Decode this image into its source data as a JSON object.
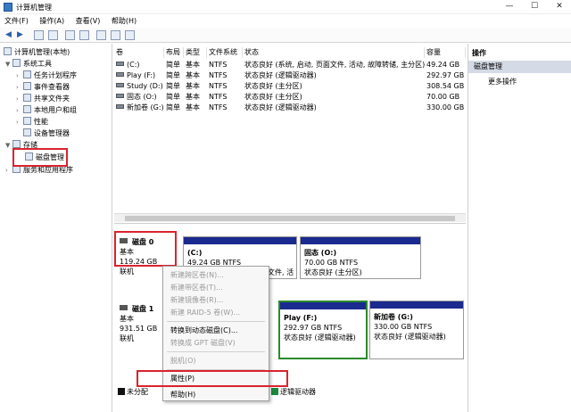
{
  "window": {
    "title": "计算机管理",
    "min": "—",
    "max": "☐",
    "close": "✕"
  },
  "menu": [
    "文件(F)",
    "操作(A)",
    "查看(V)",
    "帮助(H)"
  ],
  "tree": {
    "root": "计算机管理(本地)",
    "system_tools": "系统工具",
    "task_scheduler": "任务计划程序",
    "event_viewer": "事件查看器",
    "shared_folders": "共享文件夹",
    "local_users": "本地用户和组",
    "performance": "性能",
    "device_manager": "设备管理器",
    "storage": "存储",
    "disk_management": "磁盘管理",
    "services_apps": "服务和应用程序"
  },
  "actions": {
    "header": "操作",
    "section": "磁盘管理",
    "more": "更多操作"
  },
  "columns": [
    "卷",
    "布局",
    "类型",
    "文件系统",
    "状态",
    "容量"
  ],
  "volumes": [
    {
      "name": "(C:)",
      "layout": "简单",
      "type": "基本",
      "fs": "NTFS",
      "status": "状态良好 (系统, 启动, 页面文件, 活动, 故障转储, 主分区)",
      "capacity": "49.24 GB"
    },
    {
      "name": "Play (F:)",
      "layout": "简单",
      "type": "基本",
      "fs": "NTFS",
      "status": "状态良好 (逻辑驱动器)",
      "capacity": "292.97 GB"
    },
    {
      "name": "Study (D:)",
      "layout": "简单",
      "type": "基本",
      "fs": "NTFS",
      "status": "状态良好 (主分区)",
      "capacity": "308.54 GB"
    },
    {
      "name": "固态 (O:)",
      "layout": "简单",
      "type": "基本",
      "fs": "NTFS",
      "status": "状态良好 (主分区)",
      "capacity": "70.00 GB"
    },
    {
      "name": "新加卷 (G:)",
      "layout": "简单",
      "type": "基本",
      "fs": "NTFS",
      "status": "状态良好 (逻辑驱动器)",
      "capacity": "330.00 GB"
    }
  ],
  "disk0": {
    "name": "磁盘 0",
    "type": "基本",
    "size": "119.24 GB",
    "status": "联机",
    "part_c": {
      "name": "(C:)",
      "size": "49.24 GB NTFS",
      "status_tail": "文件, 活"
    },
    "part_o": {
      "name": "固态  (O:)",
      "size": "70.00 GB NTFS",
      "status": "状态良好 (主分区)"
    }
  },
  "disk1": {
    "name": "磁盘 1",
    "type": "基本",
    "size": "931.51 GB",
    "status": "联机",
    "part_f": {
      "name": "Play  (F:)",
      "size": "292.97 GB NTFS",
      "status": "状态良好 (逻辑驱动器)"
    },
    "part_g": {
      "name": "新加卷  (G:)",
      "size": "330.00 GB NTFS",
      "status": "状态良好 (逻辑驱动器)"
    }
  },
  "context_menu": [
    {
      "label": "新建跨区卷(N)...",
      "enabled": false
    },
    {
      "label": "新建带区卷(T)...",
      "enabled": false
    },
    {
      "label": "新建镜像卷(R)...",
      "enabled": false
    },
    {
      "label": "新建 RAID-5 卷(W)...",
      "enabled": false
    },
    {
      "label": "转换到动态磁盘(C)...",
      "enabled": true
    },
    {
      "label": "转换成 GPT 磁盘(V)",
      "enabled": false
    },
    {
      "label": "脱机(O)",
      "enabled": false
    },
    {
      "label": "属性(P)",
      "enabled": true
    },
    {
      "label": "帮助(H)",
      "enabled": true
    }
  ],
  "legend": {
    "unallocated": "未分配",
    "logical": "逻辑驱动器"
  },
  "colors": {
    "highlight": "#d9232d",
    "partition_header": "#1b2a8f",
    "selected_partition": "#2a8a2a"
  }
}
